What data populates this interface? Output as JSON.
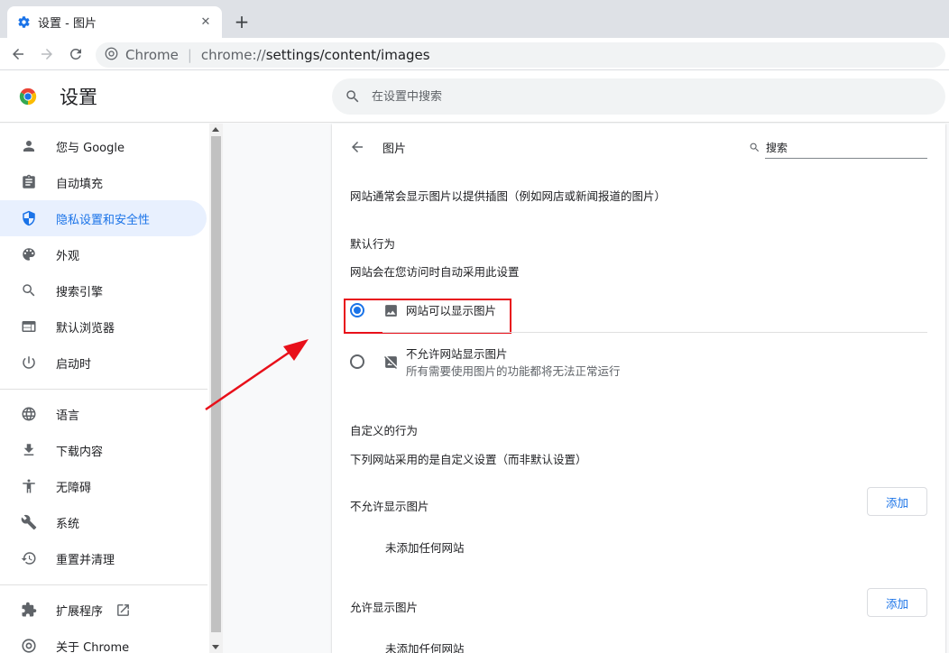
{
  "browser": {
    "tab_title": "设置 - 图片",
    "close_glyph": "✕",
    "new_tab_glyph": "+",
    "omnibox_label": "Chrome",
    "omnibox_separator": "|",
    "url_scheme": "chrome://",
    "url_path": "settings/content/images"
  },
  "header": {
    "title": "设置",
    "search_placeholder": "在设置中搜索"
  },
  "sidebar": {
    "items": [
      {
        "label": "您与 Google",
        "icon": "person-icon"
      },
      {
        "label": "自动填充",
        "icon": "clipboard-icon"
      },
      {
        "label": "隐私设置和安全性",
        "icon": "shield-icon",
        "active": true
      },
      {
        "label": "外观",
        "icon": "palette-icon"
      },
      {
        "label": "搜索引擎",
        "icon": "search-icon"
      },
      {
        "label": "默认浏览器",
        "icon": "browser-icon"
      },
      {
        "label": "启动时",
        "icon": "power-icon"
      },
      {
        "label": "语言",
        "icon": "globe-icon"
      },
      {
        "label": "下载内容",
        "icon": "download-icon"
      },
      {
        "label": "无障碍",
        "icon": "accessibility-icon"
      },
      {
        "label": "系统",
        "icon": "wrench-icon"
      },
      {
        "label": "重置并清理",
        "icon": "history-icon"
      },
      {
        "label": "扩展程序",
        "icon": "puzzle-icon"
      },
      {
        "label": "关于 Chrome",
        "icon": "chrome-icon"
      }
    ]
  },
  "content": {
    "title": "图片",
    "search_placeholder": "搜索",
    "description": "网站通常会显示图片以提供插图（例如网店或新闻报道的图片）",
    "default_heading": "默认行为",
    "default_sub": "网站会在您访问时自动采用此设置",
    "options": [
      {
        "label": "网站可以显示图片",
        "sub": "",
        "selected": true,
        "icon": "image-icon"
      },
      {
        "label": "不允许网站显示图片",
        "sub": "所有需要使用图片的功能都将无法正常运行",
        "selected": false,
        "icon": "image-off-icon"
      }
    ],
    "custom_heading": "自定义的行为",
    "custom_sub": "下列网站采用的是自定义设置（而非默认设置）",
    "block_heading": "不允许显示图片",
    "block_empty": "未添加任何网站",
    "allow_heading": "允许显示图片",
    "allow_empty": "未添加任何网站",
    "add_label": "添加"
  },
  "colors": {
    "accent": "#1a73e8",
    "active_bg": "#e8f0fe",
    "highlight_box": "#e8101a",
    "annotation_arrow": "#e8101a"
  }
}
